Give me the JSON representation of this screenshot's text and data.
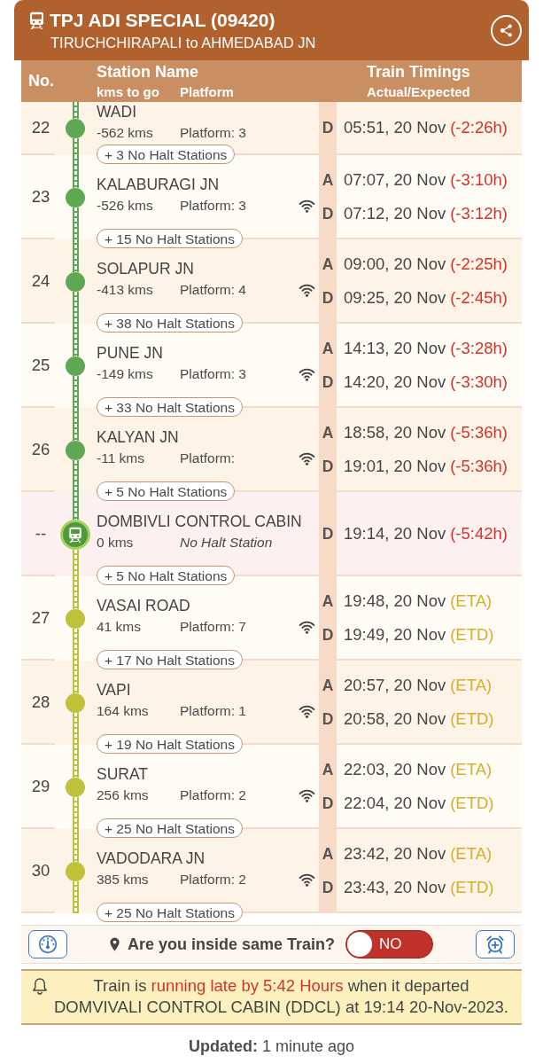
{
  "header": {
    "title": "TPJ ADI SPECIAL (09420)",
    "route": "TIRUCHCHIRAPALI to AHMEDABAD JN"
  },
  "columns": {
    "number": "No.",
    "station": "Station Name",
    "distance": "kms to go",
    "platform": "Platform",
    "timings": "Train Timings",
    "timings_note": "Actual/Expected"
  },
  "stations": [
    {
      "kind": "halt",
      "number": "22",
      "name": "WADI",
      "distance": "-562 kms",
      "platform": "Platform: 3",
      "passed": true,
      "wifi": false,
      "timings": [
        {
          "label": "D",
          "time": "05:51, 20 Nov",
          "status": "(-2:26h)",
          "kind": "delay"
        }
      ],
      "no_halt": "+ 3 No Halt Stations"
    },
    {
      "kind": "halt",
      "number": "23",
      "name": "KALABURAGI JN",
      "distance": "-526 kms",
      "platform": "Platform: 3",
      "passed": true,
      "wifi": true,
      "timings": [
        {
          "label": "A",
          "time": "07:07, 20 Nov",
          "status": "(-3:10h)",
          "kind": "delay"
        },
        {
          "label": "D",
          "time": "07:12, 20 Nov",
          "status": "(-3:12h)",
          "kind": "delay"
        }
      ],
      "no_halt": "+ 15 No Halt Stations"
    },
    {
      "kind": "halt",
      "number": "24",
      "name": "SOLAPUR JN",
      "distance": "-413 kms",
      "platform": "Platform: 4",
      "passed": true,
      "wifi": true,
      "timings": [
        {
          "label": "A",
          "time": "09:00, 20 Nov",
          "status": "(-2:25h)",
          "kind": "delay"
        },
        {
          "label": "D",
          "time": "09:25, 20 Nov",
          "status": "(-2:45h)",
          "kind": "delay"
        }
      ],
      "no_halt": "+ 38 No Halt Stations"
    },
    {
      "kind": "halt",
      "number": "25",
      "name": "PUNE JN",
      "distance": "-149 kms",
      "platform": "Platform: 3",
      "passed": true,
      "wifi": true,
      "timings": [
        {
          "label": "A",
          "time": "14:13, 20 Nov",
          "status": "(-3:28h)",
          "kind": "delay"
        },
        {
          "label": "D",
          "time": "14:20, 20 Nov",
          "status": "(-3:30h)",
          "kind": "delay"
        }
      ],
      "no_halt": "+ 33 No Halt Stations"
    },
    {
      "kind": "halt",
      "number": "26",
      "name": "KALYAN JN",
      "distance": "-11 kms",
      "platform": "Platform:",
      "passed": true,
      "wifi": true,
      "timings": [
        {
          "label": "A",
          "time": "18:58, 20 Nov",
          "status": "(-5:36h)",
          "kind": "delay"
        },
        {
          "label": "D",
          "time": "19:01, 20 Nov",
          "status": "(-5:36h)",
          "kind": "delay"
        }
      ],
      "no_halt": "+ 5 No Halt Stations"
    },
    {
      "kind": "current",
      "number": "--",
      "name": "DOMBIVLI CONTROL CABIN",
      "distance": "0 kms",
      "note": "No Halt Station",
      "wifi": false,
      "timings": [
        {
          "label": "D",
          "time": "19:14, 20 Nov",
          "status": "(-5:42h)",
          "kind": "delay"
        }
      ],
      "no_halt": "+ 5 No Halt Stations"
    },
    {
      "kind": "halt",
      "number": "27",
      "name": "VASAI ROAD",
      "distance": "41 kms",
      "platform": "Platform: 7",
      "passed": false,
      "wifi": true,
      "timings": [
        {
          "label": "A",
          "time": "19:48, 20 Nov",
          "status": "(ETA)",
          "kind": "estimate"
        },
        {
          "label": "D",
          "time": "19:49, 20 Nov",
          "status": "(ETD)",
          "kind": "estimate"
        }
      ],
      "no_halt": "+ 17 No Halt Stations"
    },
    {
      "kind": "halt",
      "number": "28",
      "name": "VAPI",
      "distance": "164 kms",
      "platform": "Platform: 1",
      "passed": false,
      "wifi": true,
      "timings": [
        {
          "label": "A",
          "time": "20:57, 20 Nov",
          "status": "(ETA)",
          "kind": "estimate"
        },
        {
          "label": "D",
          "time": "20:58, 20 Nov",
          "status": "(ETD)",
          "kind": "estimate"
        }
      ],
      "no_halt": "+ 19 No Halt Stations"
    },
    {
      "kind": "halt",
      "number": "29",
      "name": "SURAT",
      "distance": "256 kms",
      "platform": "Platform: 2",
      "passed": false,
      "wifi": true,
      "timings": [
        {
          "label": "A",
          "time": "22:03, 20 Nov",
          "status": "(ETA)",
          "kind": "estimate"
        },
        {
          "label": "D",
          "time": "22:04, 20 Nov",
          "status": "(ETD)",
          "kind": "estimate"
        }
      ],
      "no_halt": "+ 25 No Halt Stations"
    },
    {
      "kind": "halt",
      "number": "30",
      "name": "VADODARA JN",
      "distance": "385 kms",
      "platform": "Platform: 2",
      "passed": false,
      "wifi": true,
      "timings": [
        {
          "label": "A",
          "time": "23:42, 20 Nov",
          "status": "(ETA)",
          "kind": "estimate"
        },
        {
          "label": "D",
          "time": "23:43, 20 Nov",
          "status": "(ETD)",
          "kind": "estimate"
        }
      ],
      "no_halt": "+ 25 No Halt Stations"
    }
  ],
  "inside_train": {
    "question": "Are you inside same Train?",
    "on": false,
    "toggle_label": "NO"
  },
  "notice": {
    "before": "Train is ",
    "highlight": "running late by 5:42 Hours",
    "after": " when it departed DOMVIVALI CONTROL CABIN (DDCL) at 19:14 20-Nov-2023."
  },
  "updated": "**Updated:** 1 minute ago"
}
